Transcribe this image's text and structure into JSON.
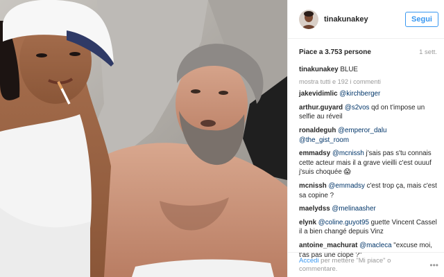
{
  "account": {
    "username": "tinakunakey",
    "follow_label": "Segui"
  },
  "post": {
    "likes": "Piace a 3.753 persone",
    "time": "1 sett."
  },
  "caption": {
    "user": "tinakunakey",
    "text": "BLUE"
  },
  "more_comments": "mostra tutti e 192 i commenti",
  "comments": [
    {
      "user": "jakevidimlic",
      "text": "@kirchberger"
    },
    {
      "user": "arthur.guyard",
      "mention": "@s2vos",
      "text": " qd on t'impose un selfie au réveil"
    },
    {
      "user": "ronaldeguh",
      "text": "@emperor_dalu @the_gist_room"
    },
    {
      "user": "emmadsy",
      "mention": "@mcnissh",
      "text": " j'sais pas s'tu connais cette acteur mais il a grave vieilli c'est ouuuf j'suis choquée 😱"
    },
    {
      "user": "mcnissh",
      "mention": "@emmadsy",
      "text": " c'est trop ça, mais c'est sa copine ?"
    },
    {
      "user": "maelydss",
      "text": "@melinaasher"
    },
    {
      "user": "elynk",
      "mention": "@coline.guyot95",
      "text": " guette Vincent Cassel il a bien changé depuis Vinz"
    },
    {
      "user": "antoine_machurat",
      "mention": "@macleca",
      "text": " \"excuse moi, t'as pas une clope ?\""
    }
  ],
  "footer": {
    "login_link": "Accedi",
    "text": " per mettere \"Mi piace\" o commentare.",
    "more_icon": "ellipsis-icon"
  }
}
